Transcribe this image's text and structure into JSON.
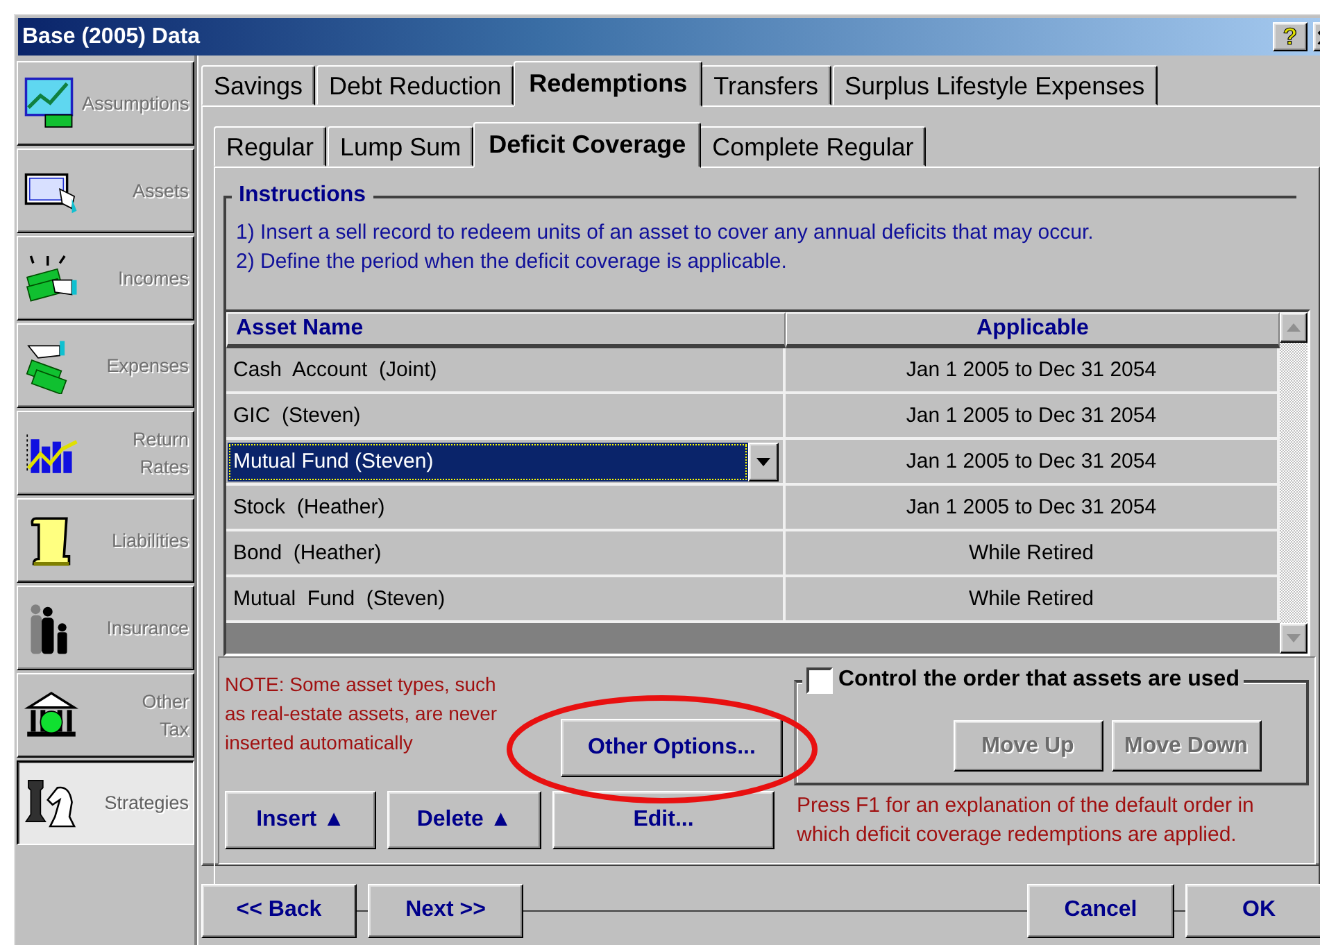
{
  "window": {
    "title": "Base (2005) Data",
    "help_button": "?"
  },
  "sidebar": {
    "items": [
      {
        "label": "Assumptions",
        "selected": false
      },
      {
        "label": "Assets",
        "selected": false
      },
      {
        "label": "Incomes",
        "selected": false
      },
      {
        "label": "Expenses",
        "selected": false
      },
      {
        "label": "Return\nRates",
        "selected": false
      },
      {
        "label": "Liabilities",
        "selected": false
      },
      {
        "label": "Insurance",
        "selected": false
      },
      {
        "label": "Other\nTax",
        "selected": false
      },
      {
        "label": "Strategies",
        "selected": true
      }
    ]
  },
  "tabs": [
    {
      "label": "Savings",
      "selected": false
    },
    {
      "label": "Debt Reduction",
      "selected": false
    },
    {
      "label": "Redemptions",
      "selected": true
    },
    {
      "label": "Transfers",
      "selected": false
    },
    {
      "label": "Surplus Lifestyle Expenses",
      "selected": false
    }
  ],
  "subtabs": [
    {
      "label": "Regular",
      "selected": false
    },
    {
      "label": "Lump Sum",
      "selected": false
    },
    {
      "label": "Deficit Coverage",
      "selected": true
    },
    {
      "label": "Complete Regular",
      "selected": false
    }
  ],
  "instructions": {
    "title": "Instructions",
    "lines": [
      "1) Insert a sell record to redeem units of an asset to cover any annual deficits that may occur.",
      "2) Define the period when the deficit coverage is applicable."
    ]
  },
  "table": {
    "columns": [
      "Asset Name",
      "Applicable"
    ],
    "rows": [
      {
        "asset": "Cash  Account  (Joint)",
        "applicable": "Jan 1 2005 to Dec 31 2054",
        "selected": false
      },
      {
        "asset": "GIC  (Steven)",
        "applicable": "Jan 1 2005 to Dec 31 2054",
        "selected": false
      },
      {
        "asset": "Mutual Fund (Steven)",
        "applicable": "Jan 1 2005 to Dec 31 2054",
        "selected": true
      },
      {
        "asset": "Stock  (Heather)",
        "applicable": "Jan 1 2005 to Dec 31 2054",
        "selected": false
      },
      {
        "asset": "Bond  (Heather)",
        "applicable": "While Retired",
        "selected": false
      },
      {
        "asset": "Mutual  Fund  (Steven)",
        "applicable": "While Retired",
        "selected": false
      }
    ]
  },
  "note": "NOTE: Some asset types, such as real-estate assets, are never inserted automatically",
  "other_options_button": {
    "label": "Other Options...",
    "highlighted": true
  },
  "order_group": {
    "label": "Control the order that assets are used",
    "checked": false,
    "buttons": [
      {
        "label": "Move Up",
        "disabled": true
      },
      {
        "label": "Move Down",
        "disabled": true
      }
    ]
  },
  "row_buttons": [
    "Insert ▲",
    "Delete ▲",
    "Edit..."
  ],
  "help_text": "Press F1 for an explanation of the default order in which deficit coverage redemptions are applied.",
  "nav_buttons": [
    "<< Back",
    "Next >>"
  ],
  "dialog_buttons": [
    "Cancel",
    "OK"
  ]
}
